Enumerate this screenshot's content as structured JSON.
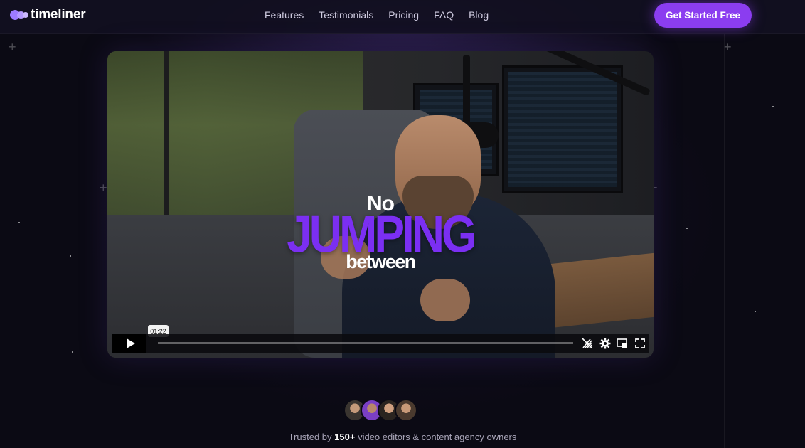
{
  "header": {
    "logo_text": "timeliner",
    "nav": [
      "Features",
      "Testimonials",
      "Pricing",
      "FAQ",
      "Blog"
    ],
    "cta_label": "Get Started Free"
  },
  "video": {
    "overlay_line1": "No",
    "overlay_line2": "JUMPING",
    "overlay_line3": "between",
    "time_tooltip": "01:22",
    "progress": 0.0
  },
  "trusted": {
    "prefix": "Trusted by",
    "count": "150+",
    "suffix": "video editors & content agency owners"
  },
  "colors": {
    "accent": "#8b3df0",
    "overlay_purple": "#7b2ff2",
    "background": "#0b0a14"
  },
  "icons": [
    "logo-mark-icon",
    "play-icon",
    "no-captions-icon",
    "settings-gear-icon",
    "picture-in-picture-icon",
    "fullscreen-icon"
  ]
}
